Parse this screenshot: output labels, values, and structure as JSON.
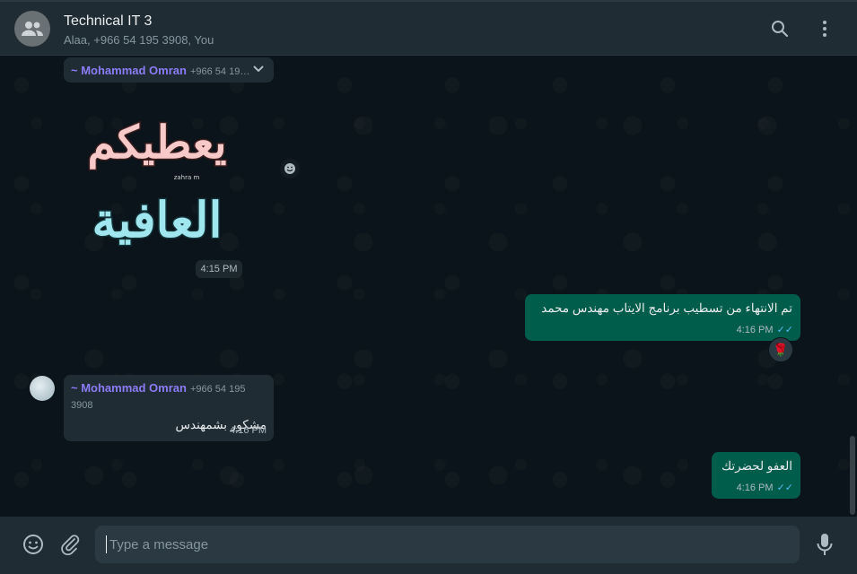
{
  "header": {
    "title": "Technical IT 3",
    "subtitle": "Alaa, +966 54 195 3908, You",
    "search_icon": "search-icon",
    "menu_icon": "kebab-menu-icon"
  },
  "messages": {
    "sticker_msg": {
      "sender": "~ Mohammad Omran",
      "phone": "+966 54 19…",
      "sticker_line1": "يعطيكم",
      "sticker_line2": "العافية",
      "sticker_mark": "zahra m",
      "time": "4:15 PM"
    },
    "out1": {
      "text": "تم الانتهاء من تسطيب برنامج الايتاب مهندس محمد",
      "time": "4:16 PM",
      "reaction": "🌹"
    },
    "in1": {
      "sender": "~ Mohammad Omran",
      "phone": "+966 54 195 3908",
      "text": "مشكور بشمهندس",
      "time": "4:16 PM"
    },
    "out2": {
      "text": "العفو لحضرتك",
      "time": "4:16 PM"
    }
  },
  "composer": {
    "placeholder": "Type a message"
  },
  "colors": {
    "header_bg": "#202c33",
    "chat_bg": "#0b141a",
    "incoming_bubble": "#202c33",
    "outgoing_bubble": "#005c4b",
    "sender_name": "#8b7cf6",
    "read_ticks": "#53bdeb"
  }
}
